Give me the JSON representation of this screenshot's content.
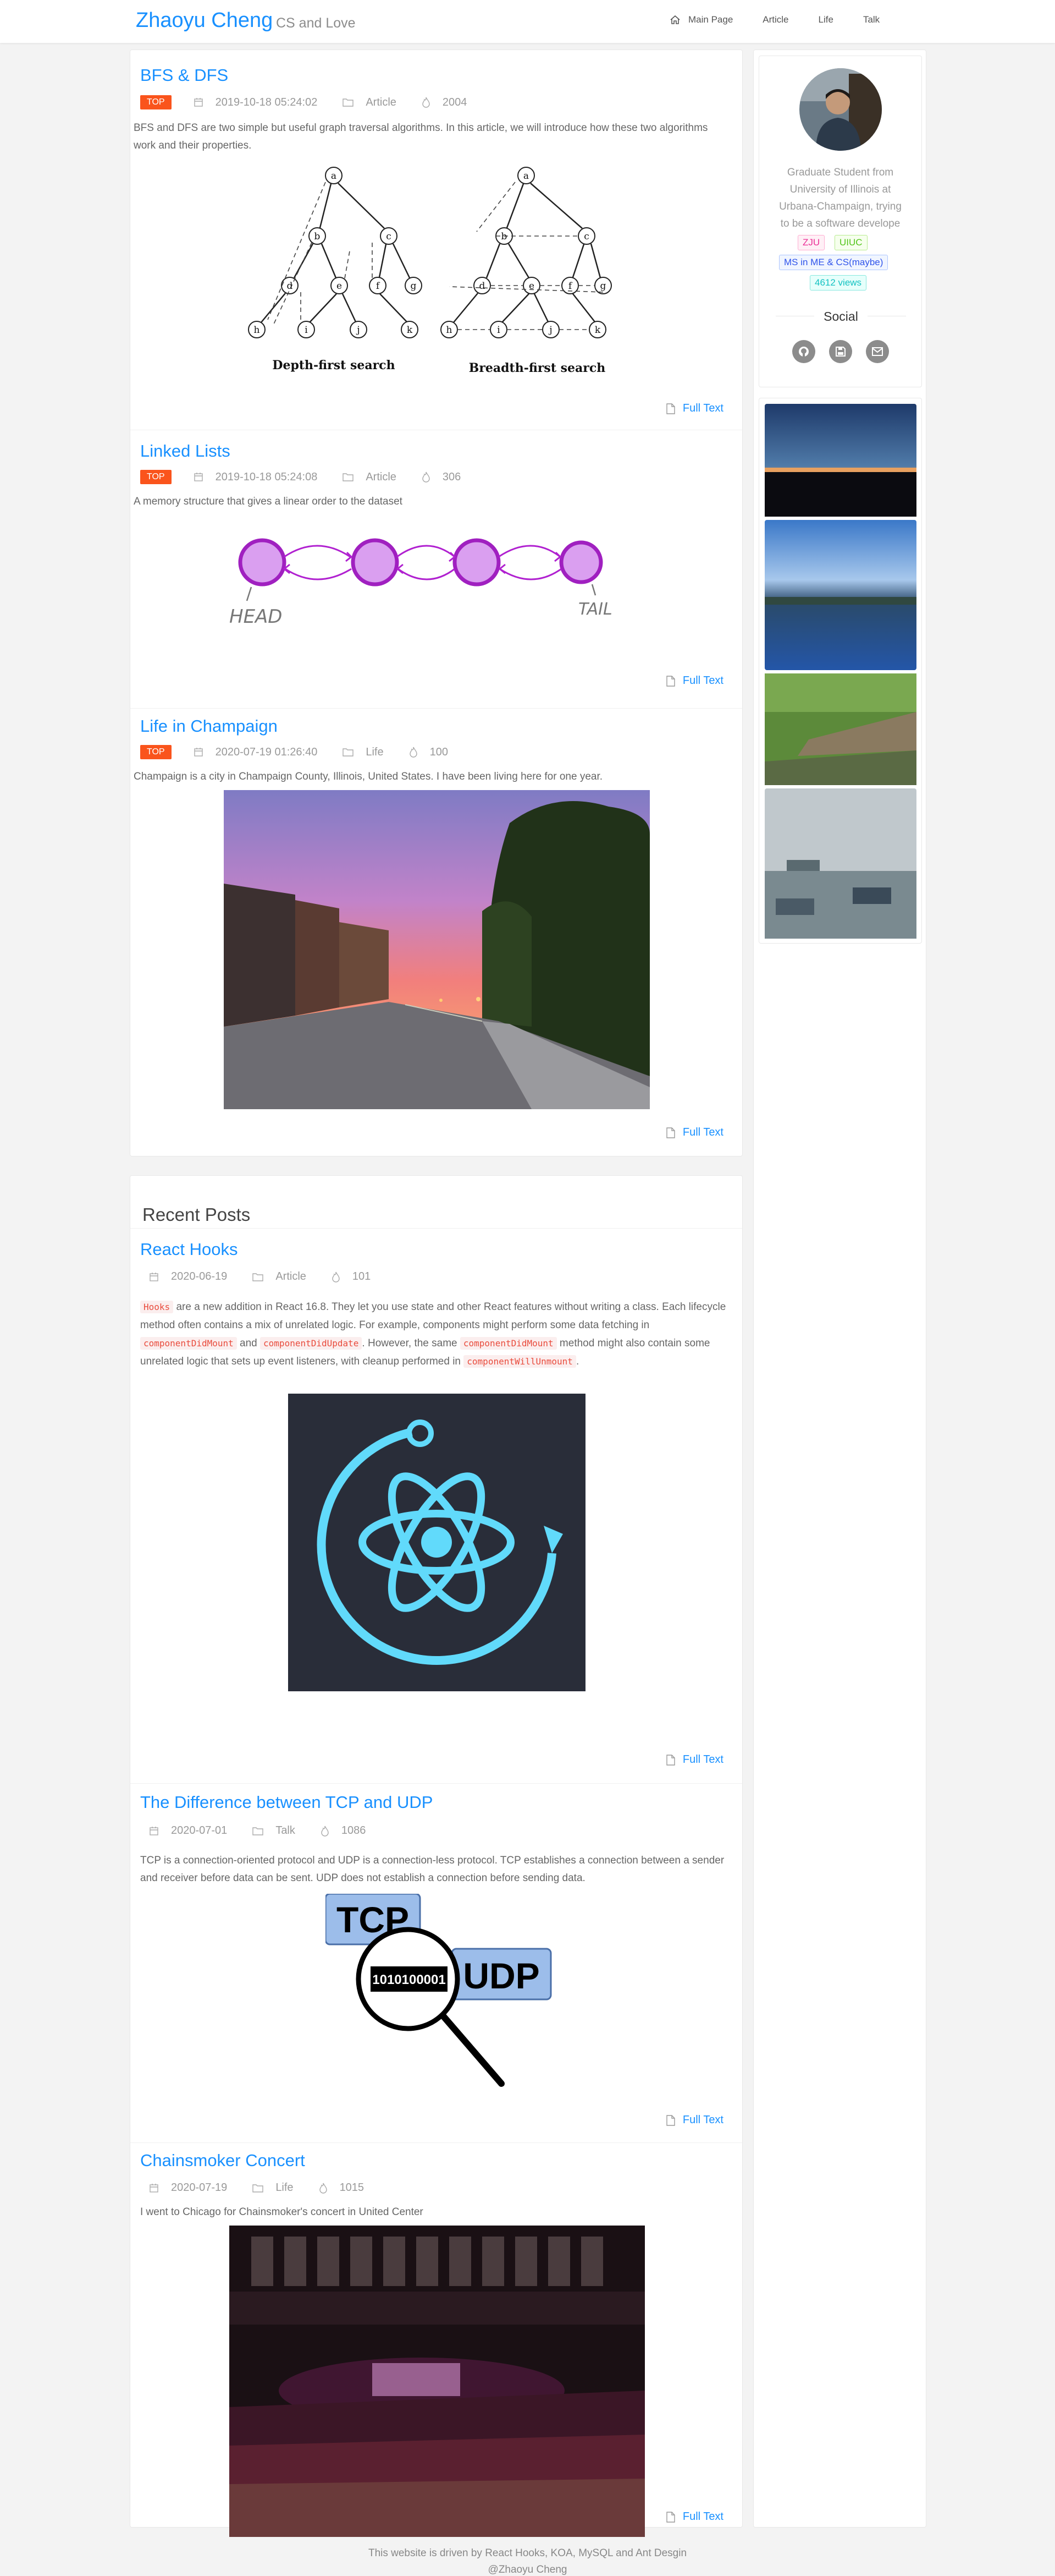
{
  "header": {
    "logo": "Zhaoyu Cheng",
    "slogan": "CS and Love",
    "nav": [
      {
        "label": "Main Page",
        "icon": "home-icon"
      },
      {
        "label": "Article"
      },
      {
        "label": "Life"
      },
      {
        "label": "Talk"
      }
    ]
  },
  "top_posts": [
    {
      "title": "BFS & DFS",
      "badge": "TOP",
      "date": "2019-10-18 05:24:02",
      "category": "Article",
      "views": "2004",
      "excerpt": "BFS and DFS are two simple but useful graph traversal algorithms. In this article, we will introduce how these two algorithms work and their properties.",
      "image_captions": [
        "Depth-first search",
        "Breadth-first search"
      ],
      "full_text": "Full Text"
    },
    {
      "title": "Linked Lists",
      "badge": "TOP",
      "date": "2019-10-18 05:24:08",
      "category": "Article",
      "views": "306",
      "excerpt": "A memory structure that gives a linear order to the dataset",
      "image_labels": [
        "HEAD",
        "TAIL"
      ],
      "full_text": "Full Text"
    },
    {
      "title": "Life in Champaign",
      "badge": "TOP",
      "date": "2020-07-19 01:26:40",
      "category": "Life",
      "views": "100",
      "excerpt": "Champaign is a city in Champaign County, Illinois, United States. I have been living here for one year.",
      "full_text": "Full Text"
    }
  ],
  "recent": {
    "heading": "Recent Posts",
    "posts": [
      {
        "title": "React Hooks",
        "date": "2020-06-19",
        "category": "Article",
        "views": "101",
        "code": [
          "Hooks",
          "componentDidMount",
          "componentDidUpdate",
          "componentDidMount",
          "componentWillUnmount"
        ],
        "text": [
          " are a new addition in React 16.8. They let you use state and other React features without writing a class. Each lifecycle method often contains a mix of unrelated logic. For example, components might perform some data fetching in ",
          " and ",
          ". However, the same ",
          " method might also contain some unrelated logic that sets up event listeners, with cleanup performed in ",
          "."
        ],
        "full_text": "Full Text"
      },
      {
        "title": "The Difference between TCP and UDP",
        "date": "2020-07-01",
        "category": "Talk",
        "views": "1086",
        "excerpt": "TCP is a connection-oriented protocol and UDP is a connection-less protocol. TCP establishes a connection between a sender and receiver before data can be sent. UDP does not establish a connection before sending data.",
        "image_labels": [
          "TCP",
          "UDP",
          "1010100001"
        ],
        "full_text": "Full Text"
      },
      {
        "title": "Chainsmoker Concert",
        "date": "2020-07-19",
        "category": "Life",
        "views": "1015",
        "excerpt": "I went to Chicago for Chainsmoker's concert in United Center",
        "full_text": "Full Text"
      }
    ]
  },
  "sidebar": {
    "bio": "Graduate Student from University of Illinois at Urbana-Champaign, trying to be a software develope",
    "tags": [
      "ZJU",
      "UIUC",
      "MS in ME & CS(maybe)",
      "4612 views"
    ],
    "social_title": "Social",
    "social": [
      "github-icon",
      "save-icon",
      "mail-icon"
    ]
  },
  "footer": {
    "text": "This website is driven by React Hooks, KOA, MySQL and Ant Desgin",
    "sub": "@Zhaoyu Cheng"
  },
  "colors": {
    "accent": "#1890ff",
    "top_badge": "#fa541c",
    "code_text": "#e94b3c"
  }
}
